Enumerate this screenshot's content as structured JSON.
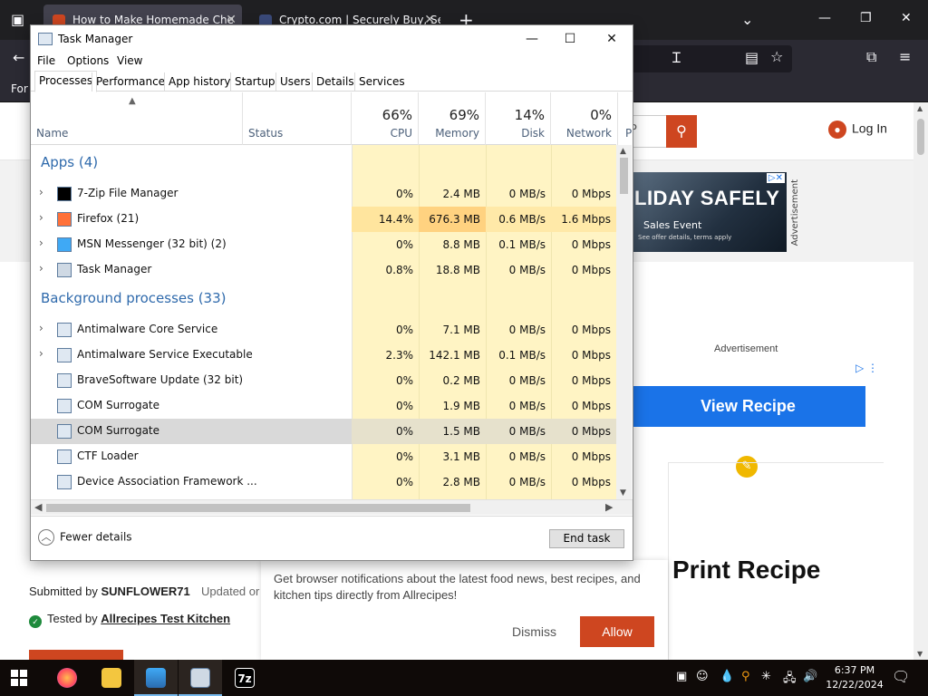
{
  "browser": {
    "tabs": [
      {
        "title": "How to Make Homemade Che",
        "active": true
      },
      {
        "title": "Crypto.com | Securely Buy, Sell",
        "active": false
      }
    ],
    "new_tab_icon": "plus-icon",
    "bookmark_text": "For"
  },
  "site": {
    "search_placeholder": "P",
    "login_label": "Log In",
    "ad_banner": {
      "headline": "LIDAY SAFELY",
      "sub": "Sales Event",
      "fine": "See offer details, terms apply"
    },
    "ad_vertical_label": "Advertisement",
    "ad_label": "Advertisement",
    "view_recipe_label": "View Recipe",
    "print_recipe_label": "Print Recipe",
    "submitted_prefix": "Submitted by ",
    "submitted_by": "SUNFLOWER71",
    "updated_label": "Updated or",
    "tested_prefix": "Tested by ",
    "tested_by": "Allrecipes Test Kitchen",
    "notification": {
      "text": "Get browser notifications about the latest food news, best recipes, and kitchen tips directly from Allrecipes!",
      "dismiss": "Dismiss",
      "allow": "Allow"
    },
    "colors": {
      "brand": "#ce4620",
      "ad_blue": "#1a73e8"
    }
  },
  "task_manager": {
    "title": "Task Manager",
    "menu": [
      "File",
      "Options",
      "View"
    ],
    "tabs": [
      "Processes",
      "Performance",
      "App history",
      "Startup",
      "Users",
      "Details",
      "Services"
    ],
    "active_tab": "Processes",
    "columns": {
      "name": "Name",
      "status": "Status",
      "cpu": {
        "pct": "66%",
        "label": "CPU"
      },
      "memory": {
        "pct": "69%",
        "label": "Memory"
      },
      "disk": {
        "pct": "14%",
        "label": "Disk"
      },
      "network": {
        "pct": "0%",
        "label": "Network"
      },
      "power": "P"
    },
    "groups": {
      "apps": "Apps (4)",
      "background": "Background processes (33)"
    },
    "apps": [
      {
        "name": "7-Zip File Manager",
        "cpu": "0%",
        "mem": "2.4 MB",
        "disk": "0 MB/s",
        "net": "0 Mbps",
        "icon": "7zip-icon"
      },
      {
        "name": "Firefox (21)",
        "cpu": "14.4%",
        "mem": "676.3 MB",
        "disk": "0.6 MB/s",
        "net": "1.6 Mbps",
        "icon": "firefox-icon"
      },
      {
        "name": "MSN Messenger (32 bit) (2)",
        "cpu": "0%",
        "mem": "8.8 MB",
        "disk": "0.1 MB/s",
        "net": "0 Mbps",
        "icon": "msn-messenger-icon"
      },
      {
        "name": "Task Manager",
        "cpu": "0.8%",
        "mem": "18.8 MB",
        "disk": "0 MB/s",
        "net": "0 Mbps",
        "icon": "task-manager-icon"
      }
    ],
    "background": [
      {
        "name": "Antimalware Core Service",
        "cpu": "0%",
        "mem": "7.1 MB",
        "disk": "0 MB/s",
        "net": "0 Mbps"
      },
      {
        "name": "Antimalware Service Executable",
        "cpu": "2.3%",
        "mem": "142.1 MB",
        "disk": "0.1 MB/s",
        "net": "0 Mbps"
      },
      {
        "name": "BraveSoftware Update (32 bit)",
        "cpu": "0%",
        "mem": "0.2 MB",
        "disk": "0 MB/s",
        "net": "0 Mbps"
      },
      {
        "name": "COM Surrogate",
        "cpu": "0%",
        "mem": "1.9 MB",
        "disk": "0 MB/s",
        "net": "0 Mbps"
      },
      {
        "name": "COM Surrogate",
        "cpu": "0%",
        "mem": "1.5 MB",
        "disk": "0 MB/s",
        "net": "0 Mbps"
      },
      {
        "name": "CTF Loader",
        "cpu": "0%",
        "mem": "3.1 MB",
        "disk": "0 MB/s",
        "net": "0 Mbps"
      },
      {
        "name": "Device Association Framework ...",
        "cpu": "0%",
        "mem": "2.8 MB",
        "disk": "0 MB/s",
        "net": "0 Mbps"
      }
    ],
    "fewer_details": "Fewer details",
    "end_task": "End task"
  },
  "taskbar": {
    "time": "6:37 PM",
    "date": "12/22/2024",
    "apps": [
      "firefox-icon",
      "file-explorer-icon",
      "msn-messenger-icon",
      "task-manager-icon",
      "7zip-icon"
    ],
    "tray": [
      "network-icon",
      "volume-icon"
    ]
  }
}
